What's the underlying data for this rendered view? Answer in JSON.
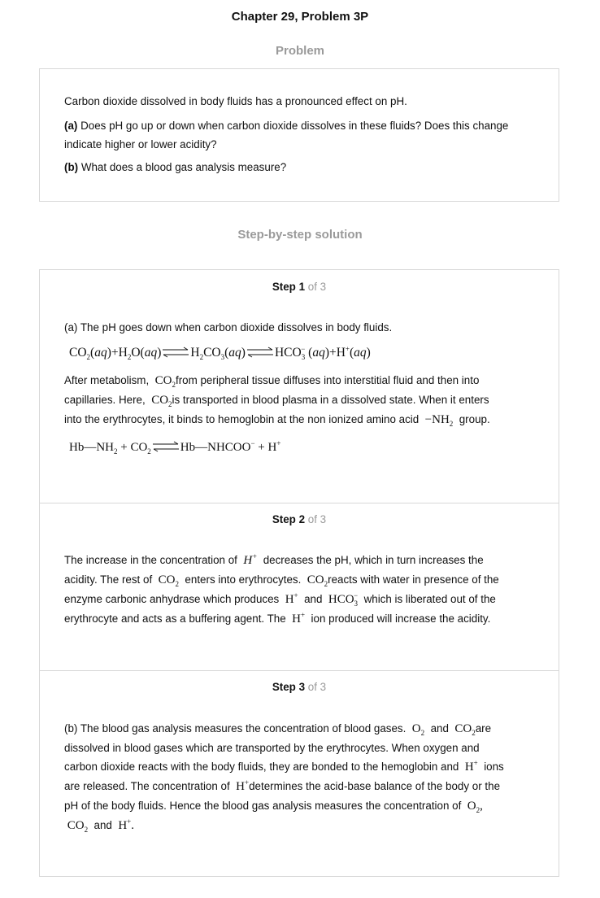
{
  "header": {
    "title": "Chapter 29, Problem 3P"
  },
  "problem": {
    "heading": "Problem",
    "intro": "Carbon dioxide dissolved in body fluids has a pronounced effect on pH.",
    "a_label": "(a)",
    "a_text": "Does pH go up or down when carbon dioxide dissolves in these fluids? Does this change indicate higher or lower acidity?",
    "b_label": "(b)",
    "b_text": "What does a blood gas analysis measure?"
  },
  "solution": {
    "heading": "Step-by-step solution",
    "of_text": "of 3",
    "step_word": "Step",
    "steps": [
      {
        "number": "1",
        "line1": "(a) The pH goes down when carbon dioxide dissolves in body fluids.",
        "p2_a": "After metabolism,",
        "p2_b": "from peripheral tissue diffuses into interstitial fluid and then into",
        "p2_c": "capillaries. Here,",
        "p2_d": "is transported in blood plasma in a dissolved state. When it enters",
        "p2_e": "into the erythrocytes, it binds to hemoglobin at the non ionized amino acid",
        "p2_f": "group."
      },
      {
        "number": "2",
        "l1_a": "The increase in the concentration of",
        "l1_b": "decreases the pH, which in turn increases the",
        "l2_a": "acidity. The rest of",
        "l2_b": "enters into erythrocytes.",
        "l2_c": "reacts with water in presence of the",
        "l3_a": "enzyme carbonic anhydrase which produces",
        "l3_b": "and",
        "l3_c": "which is liberated out of the",
        "l4_a": "erythrocyte and acts as a buffering agent. The",
        "l4_b": "ion produced will increase the acidity."
      },
      {
        "number": "3",
        "l1_a": "(b) The blood gas analysis measures the concentration of blood gases.",
        "l1_b": "and",
        "l1_c": "are",
        "l2": "dissolved in blood gases which are transported by the erythrocytes. When oxygen and",
        "l3_a": "carbon dioxide reacts with the body fluids, they are bonded to the hemoglobin and",
        "l3_b": "ions",
        "l4_a": "are released. The concentration of",
        "l4_b": "determines the acid-base balance of the body or the",
        "l5": "pH of the body fluids. Hence the blood gas analysis measures the concentration of",
        "l6_b": "and"
      }
    ]
  }
}
